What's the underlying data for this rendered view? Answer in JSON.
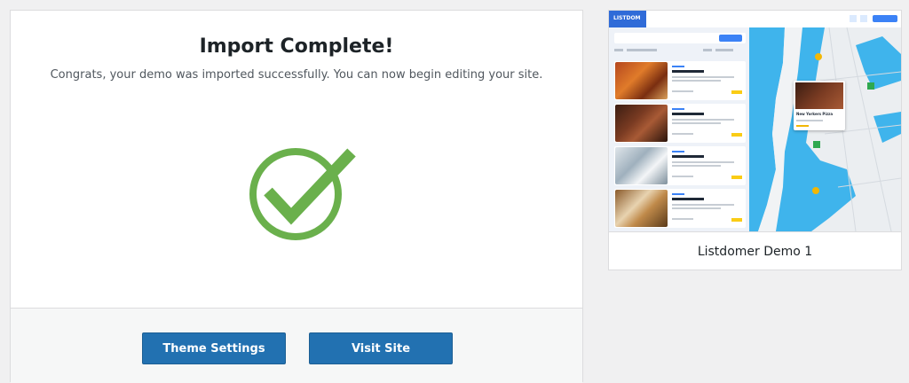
{
  "import": {
    "title": "Import Complete!",
    "subtitle": "Congrats, your demo was imported successfully. You can now begin editing your site.",
    "success_icon": "checkmark-circle-icon",
    "success_color": "#6ab04c"
  },
  "actions": {
    "theme_settings_label": "Theme Settings",
    "visit_site_label": "Visit Site",
    "button_color": "#2271b1"
  },
  "demo_card": {
    "label": "Listdomer Demo 1",
    "thumbnail": {
      "logo_text": "LISTDOM",
      "listing_title": "New Yorkers Pizza",
      "map_popup_title": "New Yorkers Pizza"
    }
  }
}
